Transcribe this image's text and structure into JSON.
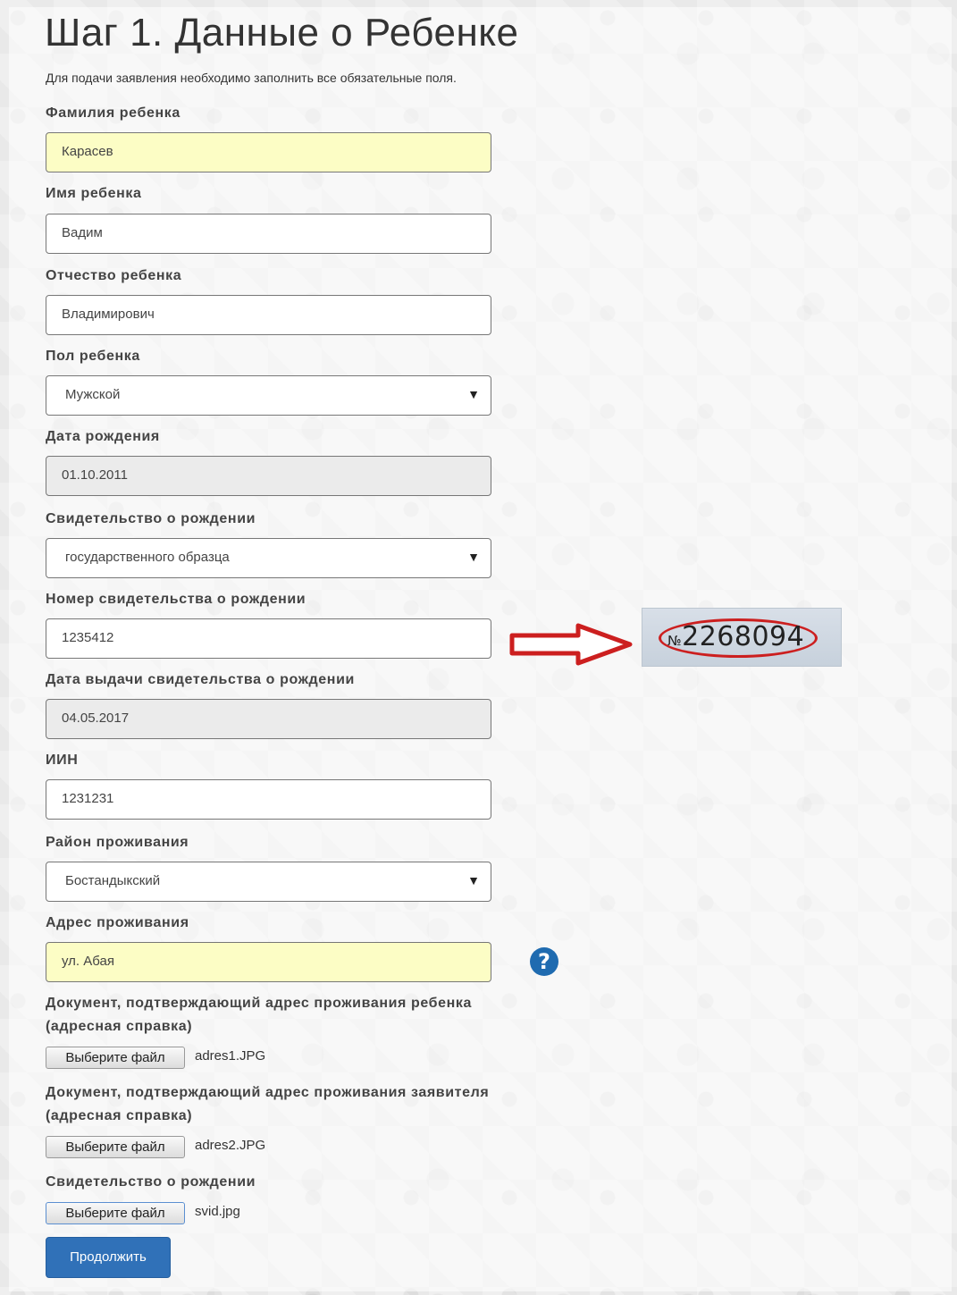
{
  "title": "Шаг 1. Данные о Ребенке",
  "intro": "Для подачи заявления необходимо заполнить все обязательные поля.",
  "fields": {
    "surname": {
      "label": "Фамилия ребенка",
      "value": "Карасев"
    },
    "name": {
      "label": "Имя ребенка",
      "value": "Вадим"
    },
    "patronymic": {
      "label": "Отчество ребенка",
      "value": "Владимирович"
    },
    "gender": {
      "label": "Пол ребенка",
      "value": "Мужской"
    },
    "birthdate": {
      "label": "Дата рождения",
      "value": "01.10.2011"
    },
    "cert_type": {
      "label": "Свидетельство о рождении",
      "value": "государственного образца"
    },
    "cert_number": {
      "label": "Номер свидетельства о рождении",
      "value": "1235412"
    },
    "cert_date": {
      "label": "Дата выдачи свидетельства о рождении",
      "value": "04.05.2017"
    },
    "iin": {
      "label": "ИИН",
      "value": "1231231"
    },
    "district": {
      "label": "Район проживания",
      "value": "Бостандыкский"
    },
    "address": {
      "label": "Адрес проживания",
      "value": "ул. Абая"
    }
  },
  "uploads": [
    {
      "label_line1": "Документ, подтверждающий адрес проживания ребенка",
      "label_line2": "(адресная справка)",
      "button": "Выберите файл",
      "file": "adres1.JPG"
    },
    {
      "label_line1": "Документ, подтверждающий адрес проживания заявителя",
      "label_line2": "(адресная справка)",
      "button": "Выберите файл",
      "file": "adres2.JPG"
    },
    {
      "label_line1": "Свидетельство о рождении",
      "label_line2": "",
      "button": "Выберите файл",
      "file": "svid.jpg"
    }
  ],
  "help_glyph": "?",
  "select_arrow": "▼",
  "cert_sample": {
    "prefix": "№",
    "number": "2268094"
  },
  "submit_label": "Продолжить",
  "colors": {
    "accent": "#3071b8",
    "highlight": "#fcfdc5",
    "readonly": "#ebebeb",
    "annotation": "#cc1f1f"
  }
}
